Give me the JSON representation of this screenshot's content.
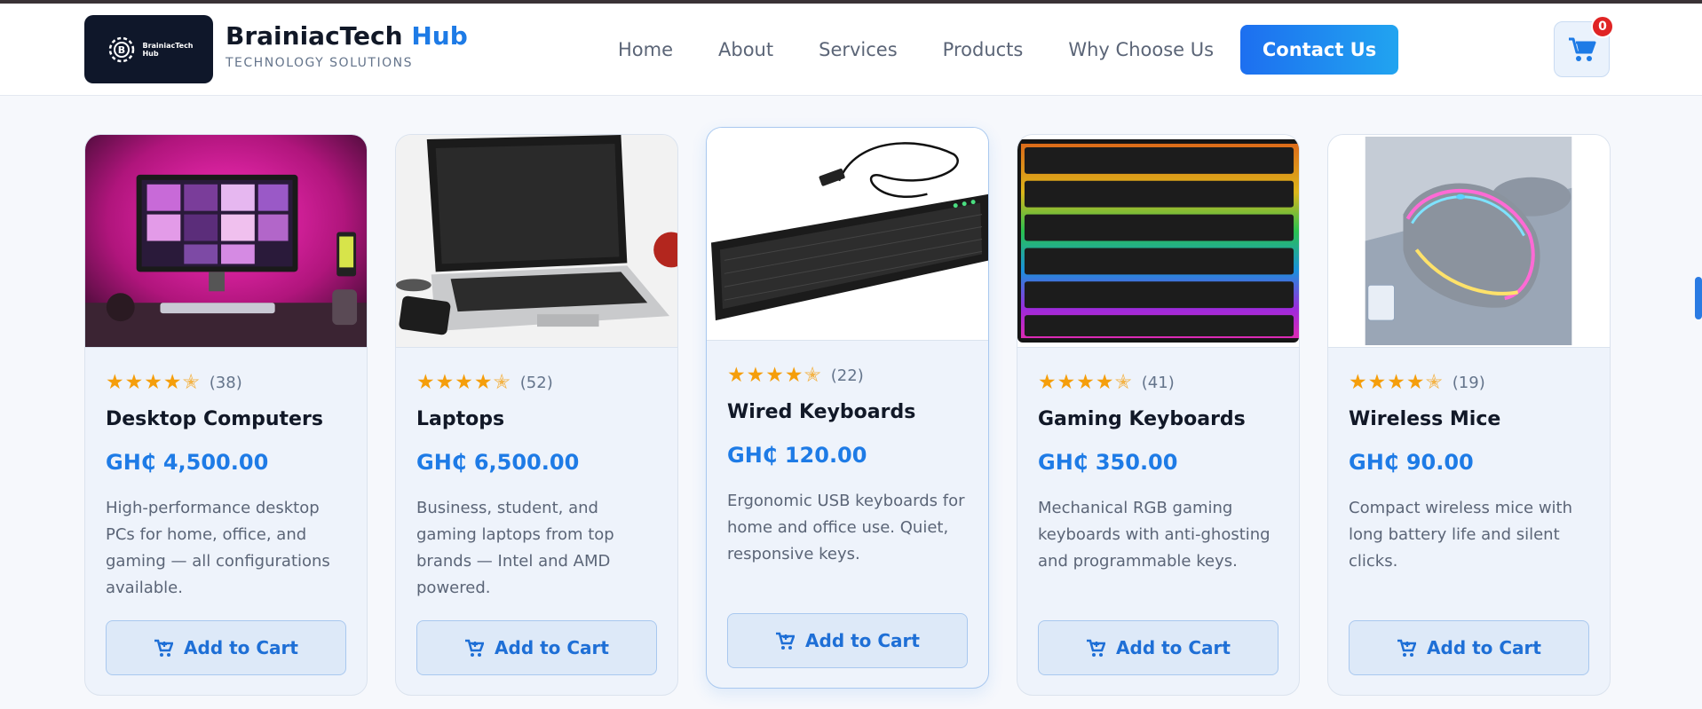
{
  "brand": {
    "logo_line1": "BrainiacTech",
    "logo_line2": "Hub",
    "name_part1": "BrainiacTech",
    "name_part2": "Hub",
    "tagline": "TECHNOLOGY SOLUTIONS"
  },
  "nav": {
    "items": [
      "Home",
      "About",
      "Services",
      "Products",
      "Why Choose Us"
    ],
    "contact": "Contact Us"
  },
  "cart": {
    "count": "0",
    "icon": "cart-icon"
  },
  "colors": {
    "accent": "#1e7be6",
    "star": "#f59e0b",
    "badge": "#e02424"
  },
  "products": [
    {
      "rating": 4.5,
      "count": "(38)",
      "title": "Desktop Computers",
      "price": "GH₵ 4,500.00",
      "desc": "High-performance desktop PCs for home, office, and gaming — all configurations available.",
      "button": "Add to Cart"
    },
    {
      "rating": 4.5,
      "count": "(52)",
      "title": "Laptops",
      "price": "GH₵ 6,500.00",
      "desc": "Business, student, and gaming laptops from top brands — Intel and AMD powered.",
      "button": "Add to Cart"
    },
    {
      "rating": 4.5,
      "count": "(22)",
      "title": "Wired Keyboards",
      "price": "GH₵ 120.00",
      "desc": "Ergonomic USB keyboards for home and office use. Quiet, responsive keys.",
      "button": "Add to Cart"
    },
    {
      "rating": 4.5,
      "count": "(41)",
      "title": "Gaming Keyboards",
      "price": "GH₵ 350.00",
      "desc": "Mechanical RGB gaming keyboards with anti-ghosting and programmable keys.",
      "button": "Add to Cart"
    },
    {
      "rating": 4.5,
      "count": "(19)",
      "title": "Wireless Mice",
      "price": "GH₵ 90.00",
      "desc": "Compact wireless mice with long battery life and silent clicks.",
      "button": "Add to Cart"
    }
  ]
}
